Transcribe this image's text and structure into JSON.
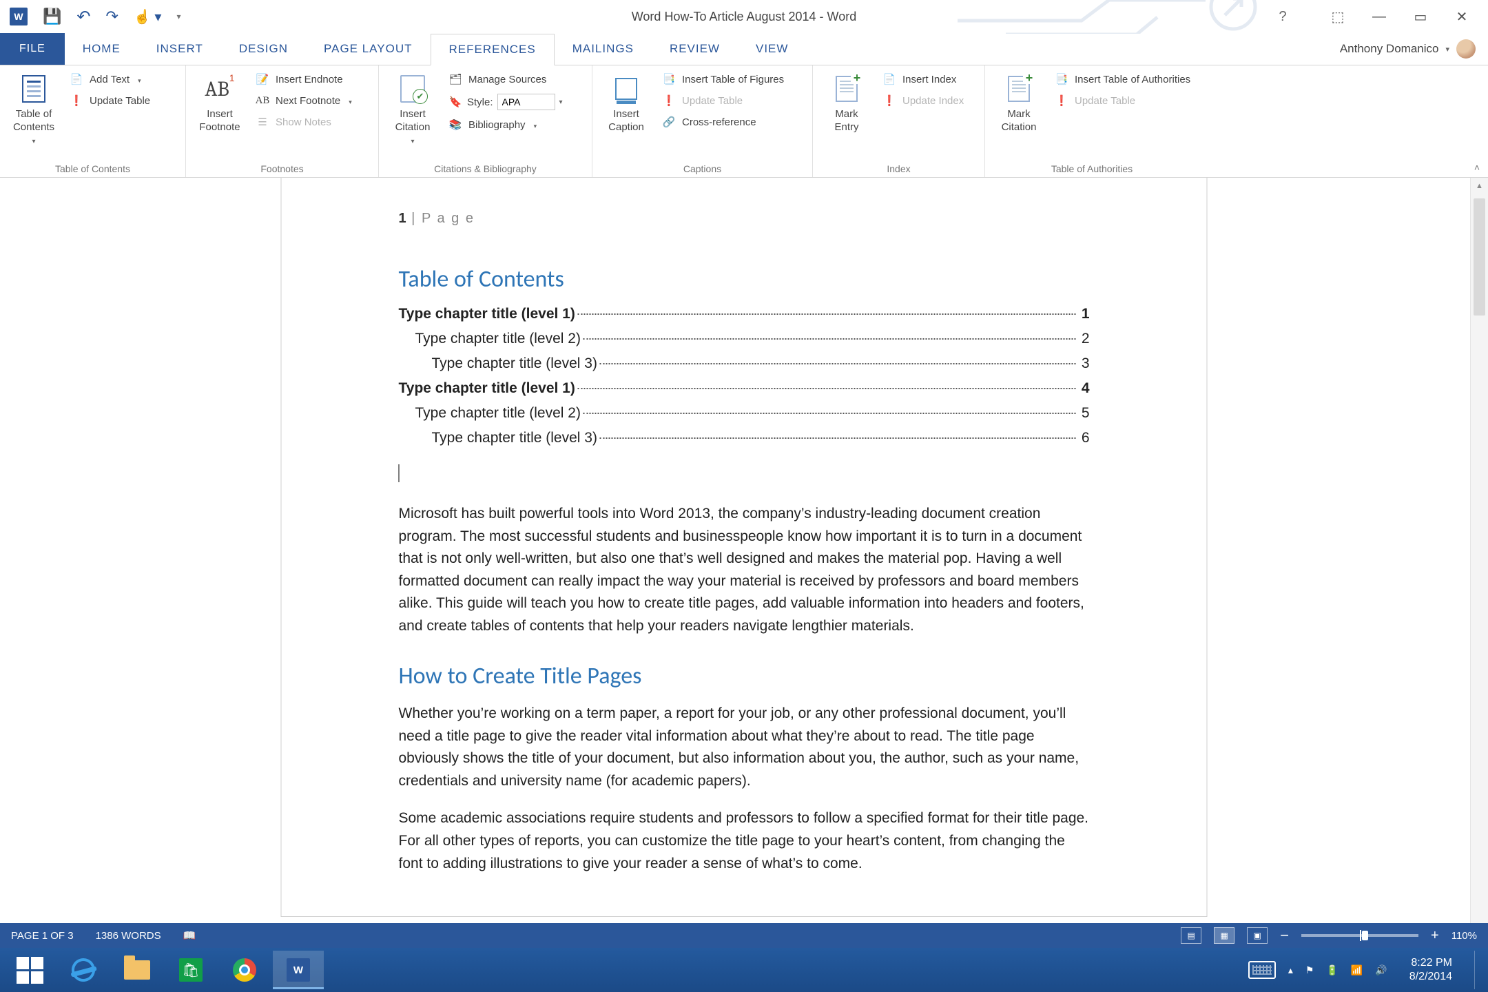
{
  "titlebar": {
    "title": "Word How-To Article August 2014 - Word"
  },
  "tabs": {
    "file": "FILE",
    "items": [
      "HOME",
      "INSERT",
      "DESIGN",
      "PAGE LAYOUT",
      "REFERENCES",
      "MAILINGS",
      "REVIEW",
      "VIEW"
    ],
    "active": "REFERENCES",
    "user": "Anthony Domanico"
  },
  "ribbon": {
    "groups": {
      "toc": {
        "label": "Table of Contents",
        "big": "Table of\nContents",
        "add": "Add Text",
        "update": "Update Table"
      },
      "fn": {
        "label": "Footnotes",
        "big": "Insert\nFootnote",
        "endnote": "Insert Endnote",
        "next": "Next Footnote",
        "show": "Show Notes"
      },
      "cit": {
        "label": "Citations & Bibliography",
        "big": "Insert\nCitation",
        "manage": "Manage Sources",
        "styleLbl": "Style:",
        "styleVal": "APA",
        "bib": "Bibliography"
      },
      "cap": {
        "label": "Captions",
        "big": "Insert\nCaption",
        "tof": "Insert Table of Figures",
        "update": "Update Table",
        "cross": "Cross-reference"
      },
      "idx": {
        "label": "Index",
        "big": "Mark\nEntry",
        "insert": "Insert Index",
        "update": "Update Index"
      },
      "toa": {
        "label": "Table of Authorities",
        "big": "Mark\nCitation",
        "insert": "Insert Table of Authorities",
        "update": "Update Table"
      }
    }
  },
  "document": {
    "headerPage": "1",
    "headerText": "P a g e",
    "tocHeading": "Table of Contents",
    "toc": [
      {
        "lvl": 1,
        "t": "Type chapter title (level 1)",
        "p": "1"
      },
      {
        "lvl": 2,
        "t": "Type chapter title (level 2)",
        "p": "2"
      },
      {
        "lvl": 3,
        "t": "Type chapter title (level 3)",
        "p": "3"
      },
      {
        "lvl": 1,
        "t": "Type chapter title (level 1)",
        "p": "4"
      },
      {
        "lvl": 2,
        "t": "Type chapter title (level 2)",
        "p": "5"
      },
      {
        "lvl": 3,
        "t": "Type chapter title (level 3)",
        "p": "6"
      }
    ],
    "p1": "Microsoft has built powerful tools into Word 2013, the company’s industry-leading document creation program. The most successful students and businesspeople know how important it is to turn in a document that is not only well-written, but also one that’s well designed and makes the material pop. Having a well formatted document can really impact the way your material is received by professors and board members alike. This guide will teach you how to create title pages, add valuable information into headers and footers, and create tables of contents that help your readers navigate lengthier materials.",
    "h2": "How to Create Title Pages",
    "p2": "Whether you’re working on a term paper, a report for your job, or any other professional document, you’ll need a title page to give the reader vital information about what they’re about to read. The title page obviously shows the title of your document, but also information about you, the author, such as your name, credentials and university name (for academic papers).",
    "p3": "Some academic associations require students and professors to follow a specified format for their title page. For all other types of reports, you can customize the title page to your heart’s content, from changing the font to adding illustrations to give your reader a sense of what’s to come."
  },
  "status": {
    "page": "PAGE 1 OF 3",
    "words": "1386 WORDS",
    "zoom": "110%"
  },
  "taskbar": {
    "time": "8:22 PM",
    "date": "8/2/2014"
  }
}
